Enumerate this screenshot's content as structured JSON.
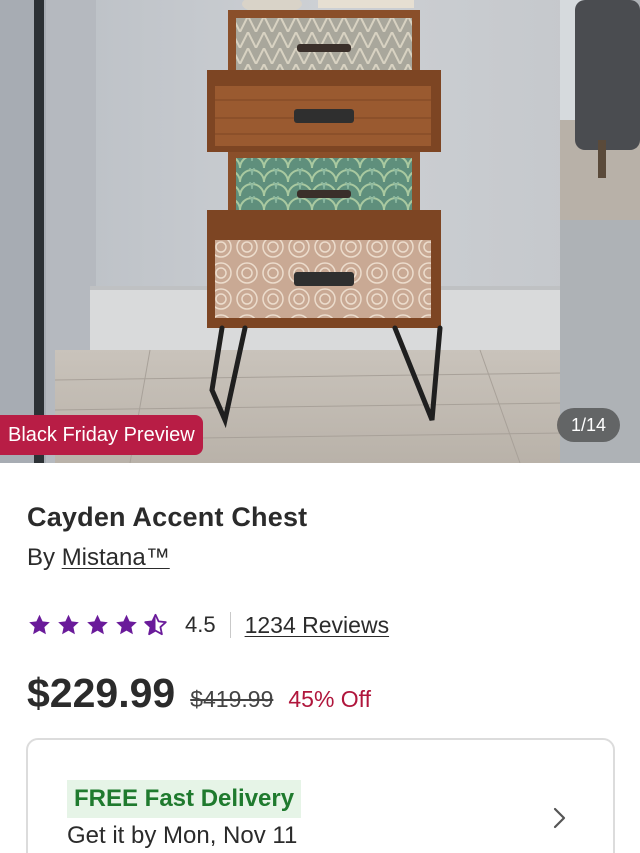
{
  "hero": {
    "badge": "Black Friday Preview",
    "counter": "1/14",
    "image_subject": "accent-chest-photo"
  },
  "product": {
    "title": "Cayden Accent Chest",
    "by_prefix": "By",
    "brand": "Mistana™",
    "rating_value": "4.5",
    "rating_stars": 4.5,
    "reviews_label": "1234 Reviews",
    "price": "$229.99",
    "was_price": "$419.99",
    "discount": "45% Off"
  },
  "delivery": {
    "tag": "FREE Fast Delivery",
    "date": "Get it by Mon, Nov 11"
  },
  "colors": {
    "badge": "#b81d45",
    "star": "#6a1b9a",
    "discount": "#b0163c",
    "delivery_tag_bg": "#e6f4e7",
    "delivery_tag_text": "#1f7a2e"
  }
}
